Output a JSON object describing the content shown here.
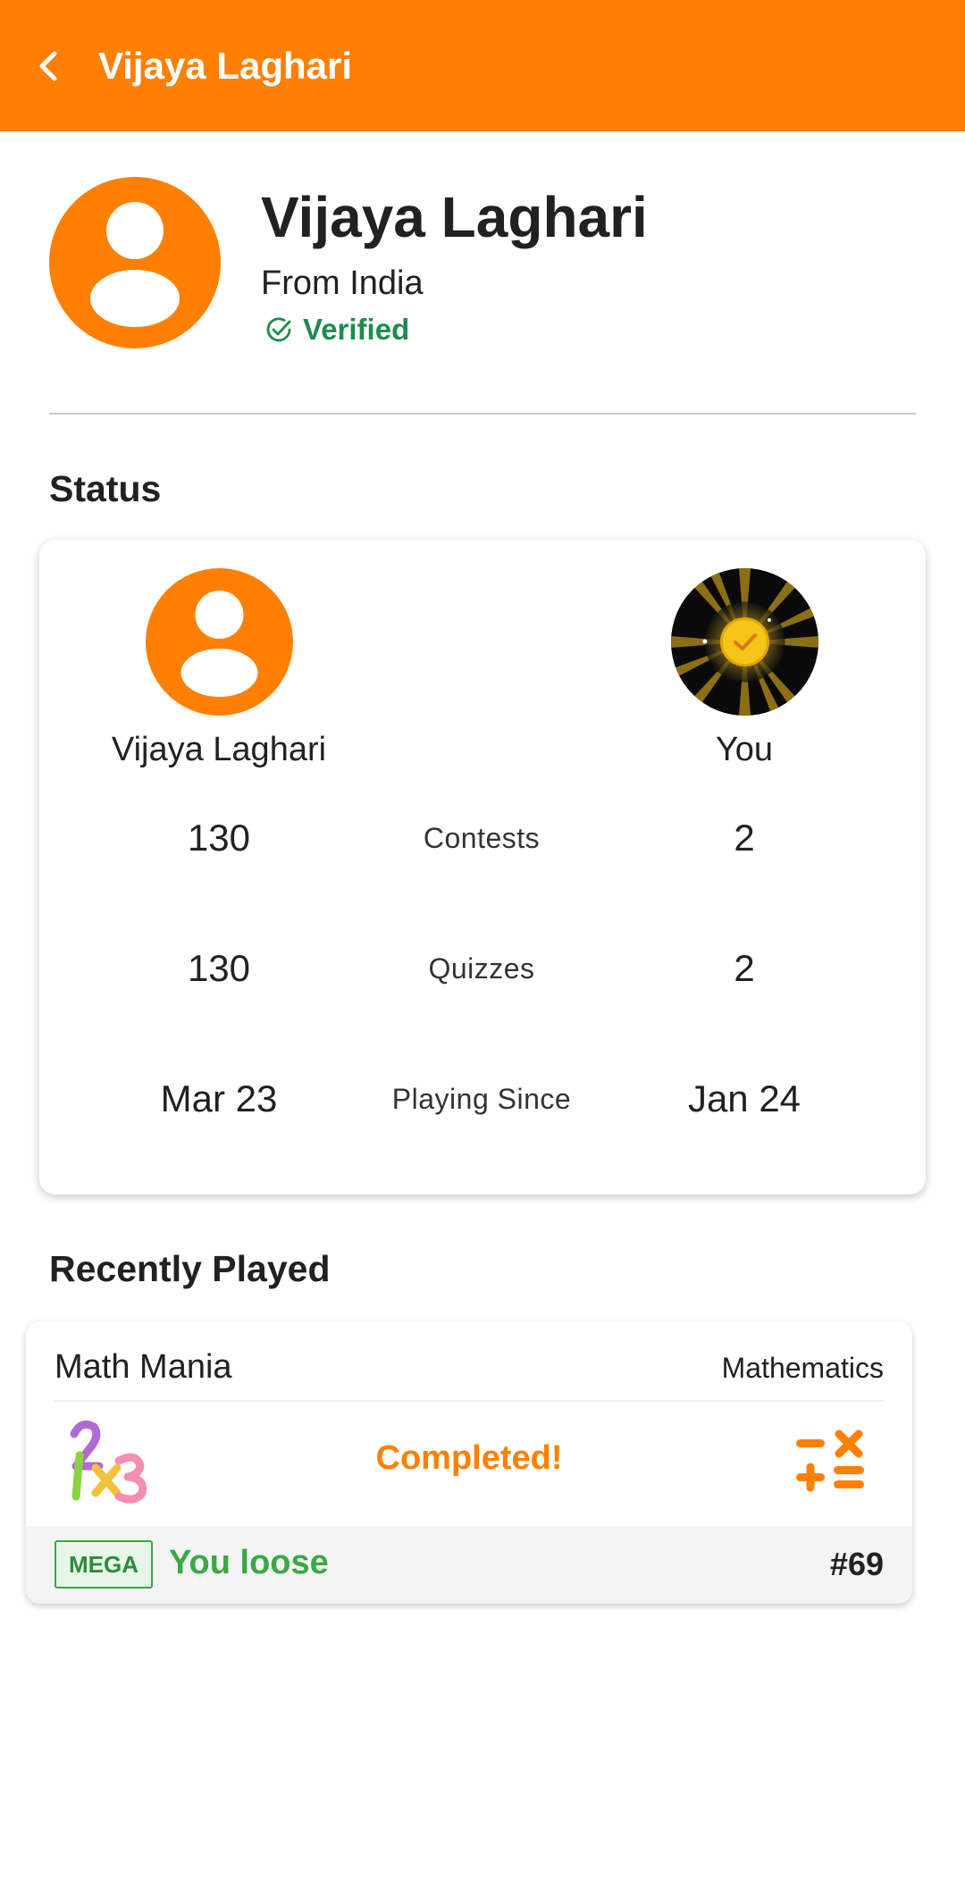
{
  "appbar": {
    "title": "Vijaya Laghari",
    "back_icon": "arrow-back-icon",
    "color": "#ff8000"
  },
  "profile": {
    "name": "Vijaya Laghari",
    "from": "From India",
    "verified_label": "Verified",
    "verified_color": "#1e8c4e",
    "avatar_icon": "person-icon"
  },
  "status": {
    "title": "Status",
    "left_player": "Vijaya Laghari",
    "right_player": "You",
    "rows": [
      {
        "label": "Contests",
        "left": "130",
        "right": "2"
      },
      {
        "label": "Quizzes",
        "left": "130",
        "right": "2"
      },
      {
        "label": "Playing Since",
        "left": "Mar 23",
        "right": "Jan 24"
      }
    ]
  },
  "recent": {
    "title": "Recently Played",
    "game_title": "Math Mania",
    "category": "Mathematics",
    "status_text": "Completed!",
    "badge": "MEGA",
    "result": "You loose",
    "rank": "#69",
    "left_icon": "math-numbers-icon",
    "right_icon": "math-operators-icon"
  }
}
